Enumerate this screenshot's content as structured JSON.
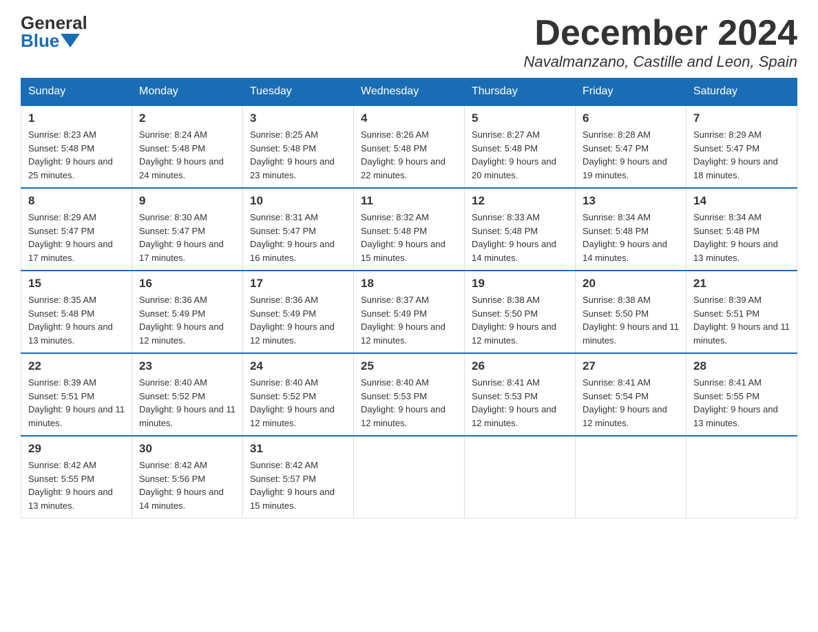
{
  "logo": {
    "general": "General",
    "blue": "Blue"
  },
  "title": "December 2024",
  "location": "Navalmanzano, Castille and Leon, Spain",
  "headers": [
    "Sunday",
    "Monday",
    "Tuesday",
    "Wednesday",
    "Thursday",
    "Friday",
    "Saturday"
  ],
  "weeks": [
    [
      {
        "day": "1",
        "sunrise": "8:23 AM",
        "sunset": "5:48 PM",
        "daylight": "9 hours and 25 minutes."
      },
      {
        "day": "2",
        "sunrise": "8:24 AM",
        "sunset": "5:48 PM",
        "daylight": "9 hours and 24 minutes."
      },
      {
        "day": "3",
        "sunrise": "8:25 AM",
        "sunset": "5:48 PM",
        "daylight": "9 hours and 23 minutes."
      },
      {
        "day": "4",
        "sunrise": "8:26 AM",
        "sunset": "5:48 PM",
        "daylight": "9 hours and 22 minutes."
      },
      {
        "day": "5",
        "sunrise": "8:27 AM",
        "sunset": "5:48 PM",
        "daylight": "9 hours and 20 minutes."
      },
      {
        "day": "6",
        "sunrise": "8:28 AM",
        "sunset": "5:47 PM",
        "daylight": "9 hours and 19 minutes."
      },
      {
        "day": "7",
        "sunrise": "8:29 AM",
        "sunset": "5:47 PM",
        "daylight": "9 hours and 18 minutes."
      }
    ],
    [
      {
        "day": "8",
        "sunrise": "8:29 AM",
        "sunset": "5:47 PM",
        "daylight": "9 hours and 17 minutes."
      },
      {
        "day": "9",
        "sunrise": "8:30 AM",
        "sunset": "5:47 PM",
        "daylight": "9 hours and 17 minutes."
      },
      {
        "day": "10",
        "sunrise": "8:31 AM",
        "sunset": "5:47 PM",
        "daylight": "9 hours and 16 minutes."
      },
      {
        "day": "11",
        "sunrise": "8:32 AM",
        "sunset": "5:48 PM",
        "daylight": "9 hours and 15 minutes."
      },
      {
        "day": "12",
        "sunrise": "8:33 AM",
        "sunset": "5:48 PM",
        "daylight": "9 hours and 14 minutes."
      },
      {
        "day": "13",
        "sunrise": "8:34 AM",
        "sunset": "5:48 PM",
        "daylight": "9 hours and 14 minutes."
      },
      {
        "day": "14",
        "sunrise": "8:34 AM",
        "sunset": "5:48 PM",
        "daylight": "9 hours and 13 minutes."
      }
    ],
    [
      {
        "day": "15",
        "sunrise": "8:35 AM",
        "sunset": "5:48 PM",
        "daylight": "9 hours and 13 minutes."
      },
      {
        "day": "16",
        "sunrise": "8:36 AM",
        "sunset": "5:49 PM",
        "daylight": "9 hours and 12 minutes."
      },
      {
        "day": "17",
        "sunrise": "8:36 AM",
        "sunset": "5:49 PM",
        "daylight": "9 hours and 12 minutes."
      },
      {
        "day": "18",
        "sunrise": "8:37 AM",
        "sunset": "5:49 PM",
        "daylight": "9 hours and 12 minutes."
      },
      {
        "day": "19",
        "sunrise": "8:38 AM",
        "sunset": "5:50 PM",
        "daylight": "9 hours and 12 minutes."
      },
      {
        "day": "20",
        "sunrise": "8:38 AM",
        "sunset": "5:50 PM",
        "daylight": "9 hours and 11 minutes."
      },
      {
        "day": "21",
        "sunrise": "8:39 AM",
        "sunset": "5:51 PM",
        "daylight": "9 hours and 11 minutes."
      }
    ],
    [
      {
        "day": "22",
        "sunrise": "8:39 AM",
        "sunset": "5:51 PM",
        "daylight": "9 hours and 11 minutes."
      },
      {
        "day": "23",
        "sunrise": "8:40 AM",
        "sunset": "5:52 PM",
        "daylight": "9 hours and 11 minutes."
      },
      {
        "day": "24",
        "sunrise": "8:40 AM",
        "sunset": "5:52 PM",
        "daylight": "9 hours and 12 minutes."
      },
      {
        "day": "25",
        "sunrise": "8:40 AM",
        "sunset": "5:53 PM",
        "daylight": "9 hours and 12 minutes."
      },
      {
        "day": "26",
        "sunrise": "8:41 AM",
        "sunset": "5:53 PM",
        "daylight": "9 hours and 12 minutes."
      },
      {
        "day": "27",
        "sunrise": "8:41 AM",
        "sunset": "5:54 PM",
        "daylight": "9 hours and 12 minutes."
      },
      {
        "day": "28",
        "sunrise": "8:41 AM",
        "sunset": "5:55 PM",
        "daylight": "9 hours and 13 minutes."
      }
    ],
    [
      {
        "day": "29",
        "sunrise": "8:42 AM",
        "sunset": "5:55 PM",
        "daylight": "9 hours and 13 minutes."
      },
      {
        "day": "30",
        "sunrise": "8:42 AM",
        "sunset": "5:56 PM",
        "daylight": "9 hours and 14 minutes."
      },
      {
        "day": "31",
        "sunrise": "8:42 AM",
        "sunset": "5:57 PM",
        "daylight": "9 hours and 15 minutes."
      },
      null,
      null,
      null,
      null
    ]
  ]
}
